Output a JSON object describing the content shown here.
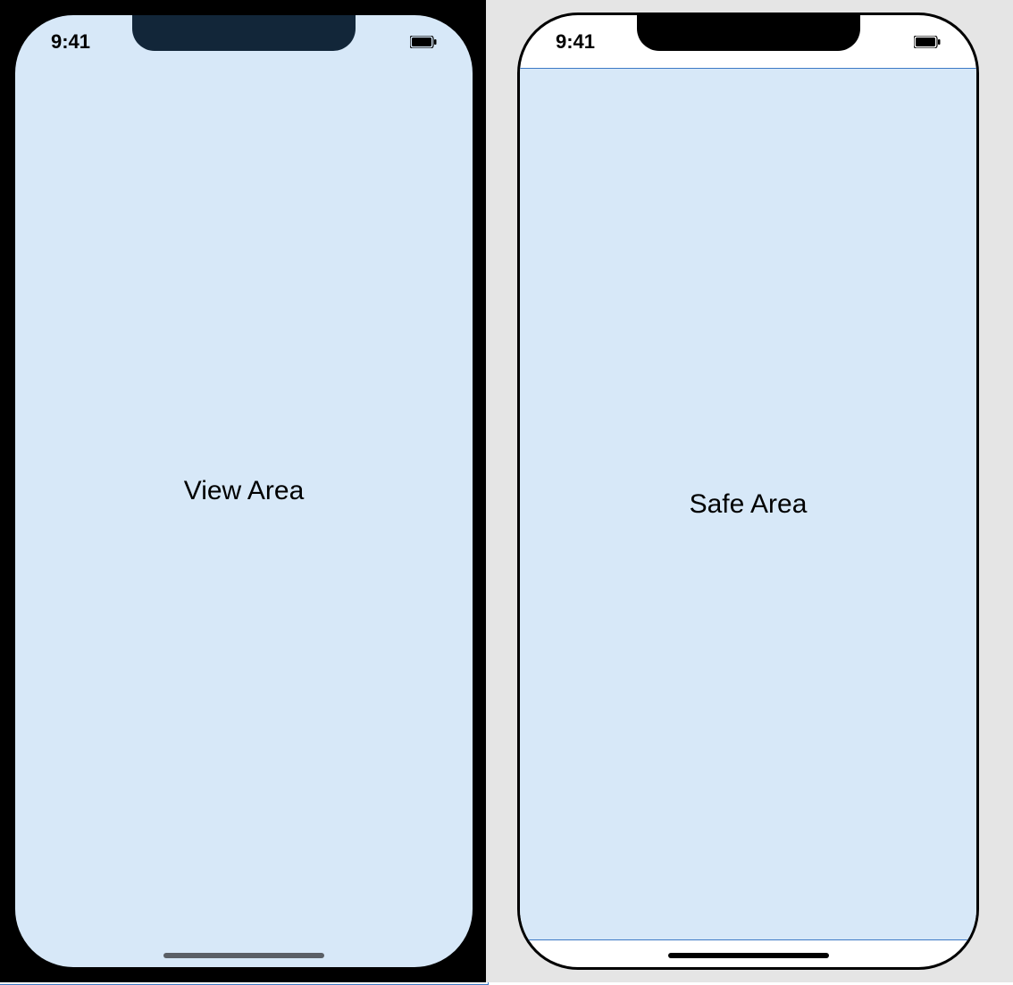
{
  "status": {
    "time": "9:41"
  },
  "labels": {
    "view_area": "View Area",
    "safe_area": "Safe Area"
  },
  "icons": {
    "battery": "battery-icon",
    "home_indicator": "home-indicator-bar"
  },
  "colors": {
    "highlight_fill": "#d7e8f8",
    "highlight_stroke": "#3c79c5",
    "notch_left": "#122639",
    "notch_right": "#000000",
    "bg_left_panel": "#000000",
    "bg_right_panel": "#e5e5e5"
  }
}
